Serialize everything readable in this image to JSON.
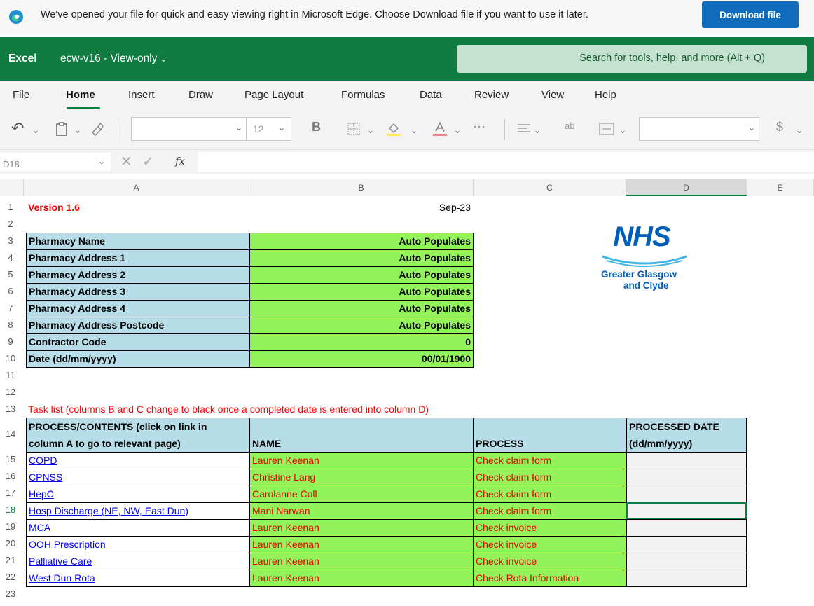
{
  "infobar": {
    "message": "We've opened your file for quick and easy viewing right in Microsoft Edge. Choose Download file if you want to use it later.",
    "download_label": "Download file"
  },
  "header": {
    "app": "Excel",
    "file": "ecw-v16  -  View-only",
    "search_placeholder": "Search for tools, help, and more (Alt + Q)"
  },
  "tabs": [
    "File",
    "Home",
    "Insert",
    "Draw",
    "Page Layout",
    "Formulas",
    "Data",
    "Review",
    "View",
    "Help"
  ],
  "active_tab": "Home",
  "toolbar": {
    "font_size": "12",
    "bold": "B"
  },
  "formula_bar": {
    "cell_ref": "D18",
    "fx": "fx",
    "value": ""
  },
  "columns": [
    "A",
    "B",
    "C",
    "D",
    "E"
  ],
  "rows": [
    "1",
    "2",
    "3",
    "4",
    "5",
    "6",
    "7",
    "8",
    "9",
    "10",
    "11",
    "12",
    "13",
    "14",
    "15",
    "16",
    "17",
    "18",
    "19",
    "20",
    "21",
    "22",
    "23"
  ],
  "sheet": {
    "version": "Version 1.6",
    "month": "Sep-23",
    "info_rows": [
      {
        "label": "Pharmacy Name",
        "value": "Auto Populates"
      },
      {
        "label": "Pharmacy Address 1",
        "value": "Auto Populates"
      },
      {
        "label": "Pharmacy Address 2",
        "value": "Auto Populates"
      },
      {
        "label": "Pharmacy Address 3",
        "value": "Auto Populates"
      },
      {
        "label": "Pharmacy Address 4",
        "value": "Auto Populates"
      },
      {
        "label": "Pharmacy Address Postcode",
        "value": "Auto Populates"
      },
      {
        "label": "Contractor Code",
        "value": "0"
      },
      {
        "label": "Date  (dd/mm/yyyy)",
        "value": "00/01/1900"
      }
    ],
    "task_note": "Task list (columns B and C change to black once a completed date is entered into column D)",
    "task_headers": {
      "a_line1": "PROCESS/CONTENTS (click on link in",
      "a_line2": "column A to go to relevant page)",
      "b": "NAME",
      "c": "PROCESS",
      "d_line1": "PROCESSED DATE",
      "d_line2": "(dd/mm/yyyy)"
    },
    "tasks": [
      {
        "content": "COPD",
        "name": "Lauren Keenan",
        "process": "Check claim form"
      },
      {
        "content": "CPNSS",
        "name": "Christine Lang",
        "process": "Check claim form"
      },
      {
        "content": "HepC",
        "name": "Carolanne Coll",
        "process": "Check claim form"
      },
      {
        "content": "Hosp Discharge (NE, NW, East Dun)",
        "name": "Mani Narwan",
        "process": "Check claim form"
      },
      {
        "content": "MCA",
        "name": "Lauren Keenan",
        "process": "Check invoice"
      },
      {
        "content": "OOH Prescription",
        "name": "Lauren Keenan",
        "process": "Check invoice"
      },
      {
        "content": "Palliative Care",
        "name": "Lauren Keenan",
        "process": "Check invoice"
      },
      {
        "content": "West Dun Rota",
        "name": "Lauren Keenan",
        "process": "Check Rota Information"
      }
    ]
  },
  "logo": {
    "brand": "NHS",
    "line1": "Greater Glasgow",
    "line2": "and Clyde"
  },
  "colors": {
    "excel_green": "#107c41",
    "label_blue": "#b7dee8",
    "value_green": "#92f35b",
    "red_text": "#e60000"
  }
}
